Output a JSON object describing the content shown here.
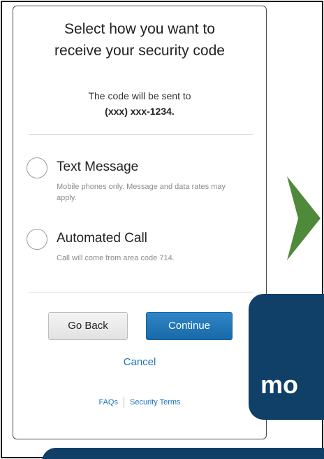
{
  "header": {
    "title_line1": "Select how you want to",
    "title_line2": "receive your security code"
  },
  "code_info": {
    "intro": "The code will be sent to",
    "phone": "(xxx) xxx-1234."
  },
  "options": [
    {
      "label": "Text Message",
      "description": "Mobile phones only. Message and data rates may apply.",
      "selected": false
    },
    {
      "label": "Automated Call",
      "description": "Call will come from area code 714.",
      "selected": false
    }
  ],
  "actions": {
    "back_label": "Go Back",
    "continue_label": "Continue",
    "cancel_label": "Cancel"
  },
  "footer": {
    "faqs_label": "FAQs",
    "terms_label": "Security Terms"
  },
  "callout": {
    "text": "mo"
  },
  "icons": {
    "next_arrow": "chevron-right-icon"
  },
  "colors": {
    "accent_blue": "#1b75bb",
    "button_blue": "#2279bc",
    "callout_navy": "#103f68",
    "arrow_green": "#4f8a3a"
  }
}
